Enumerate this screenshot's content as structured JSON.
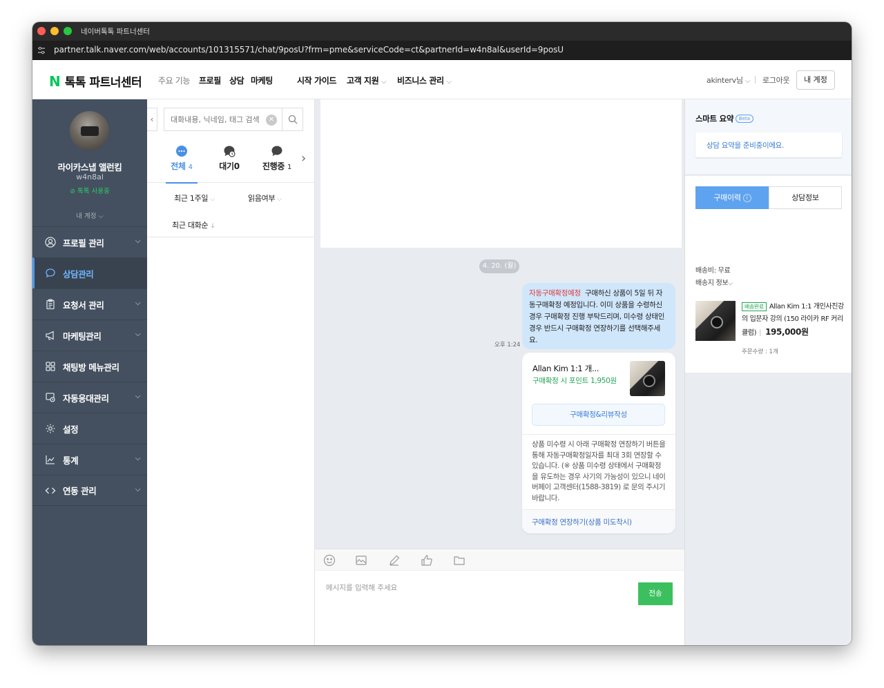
{
  "window": {
    "title": "네이버톡톡 파트너센터",
    "url": "partner.talk.naver.com/web/accounts/101315571/chat/9posU?frm=pme&serviceCode=ct&partnerId=w4n8al&userId=9posU"
  },
  "topnav": {
    "logo_mark": "N",
    "logo_text": "톡톡 파트너센터",
    "items": [
      "주요 기능",
      "프로필",
      "상담",
      "마케팅",
      "시작 가이드",
      "고객 지원",
      "비즈니스 관리"
    ],
    "user": "akinterv님",
    "logout": "로그아웃",
    "my_account": "내 계정"
  },
  "sidebar": {
    "profile_name": "라이카스냅 앨런킴",
    "profile_id": "w4n8al",
    "status": "톡톡 사용중",
    "my_account": "내 계정",
    "menu": [
      "프로필 관리",
      "상담관리",
      "요청서 관리",
      "마케팅관리",
      "채팅방 메뉴관리",
      "자동응대관리",
      "설정",
      "통계",
      "연동 관리"
    ]
  },
  "convlist": {
    "search_placeholder": "대화내용, 닉네임, 태그 검색",
    "tabs": [
      {
        "label": "전체",
        "count": "4"
      },
      {
        "label": "대기",
        "count": "0"
      },
      {
        "label": "진행중",
        "count": "1"
      }
    ],
    "filter_period": "최근 1주일",
    "filter_read": "읽음여부",
    "sort": "최근 대화순"
  },
  "chat": {
    "date": "4. 20. (월)",
    "time": "오후 1:24",
    "bubble_tag": "자동구매확정예정",
    "bubble_text": "구매하신 상품이 5일 뒤 자동구매확정 예정입니다. 이미 상품을 수령하신 경우 구매확정 진행 부탁드리며, 미수령 상태인 경우 반드시 구매확정 연장하기를 선택해주세요.",
    "card_title": "Allan Kim 1:1 개...",
    "card_point": "구매확정 시 포인트 1,950원",
    "card_button": "구매확정&리뷰작성",
    "card_notice": "상품 미수령 시 아래 구매확정 연장하기 버튼을 통해 자동구매확정일자를 최대 3회 연장할 수 있습니다. (※ 상품 미수령 상태에서 구매확정을 유도하는 경우 사기의 가능성이 있으니 네이버페이 고객센터(1588-3819) 로 문의 주시기 바랍니다.",
    "card_link": "구매확정 연장하기(상품 미도착시)",
    "input_placeholder": "메시지를 입력해 주세요",
    "send": "전송"
  },
  "rpanel": {
    "smart_title": "스마트 요약",
    "beta": "Beta",
    "smart_msg": "상담 요약을 준비중이에요.",
    "tab_purchase": "구매이력",
    "tab_info": "상담정보",
    "shipping_fee": "배송비: 무료",
    "shipping_info": "배송지 정보",
    "badge": "배송완료",
    "product_name": "Allan Kim 1:1 개인사진강의 입문자 강의 (150 라이카 RF 커리큘럼)",
    "price": "195,000원",
    "qty": "주문수량 : 1개"
  },
  "colors": {
    "brand_green": "#03c75a",
    "sidebar_bg": "#44505f",
    "accent_blue": "#4a90e2",
    "send_green": "#3cc05f"
  }
}
